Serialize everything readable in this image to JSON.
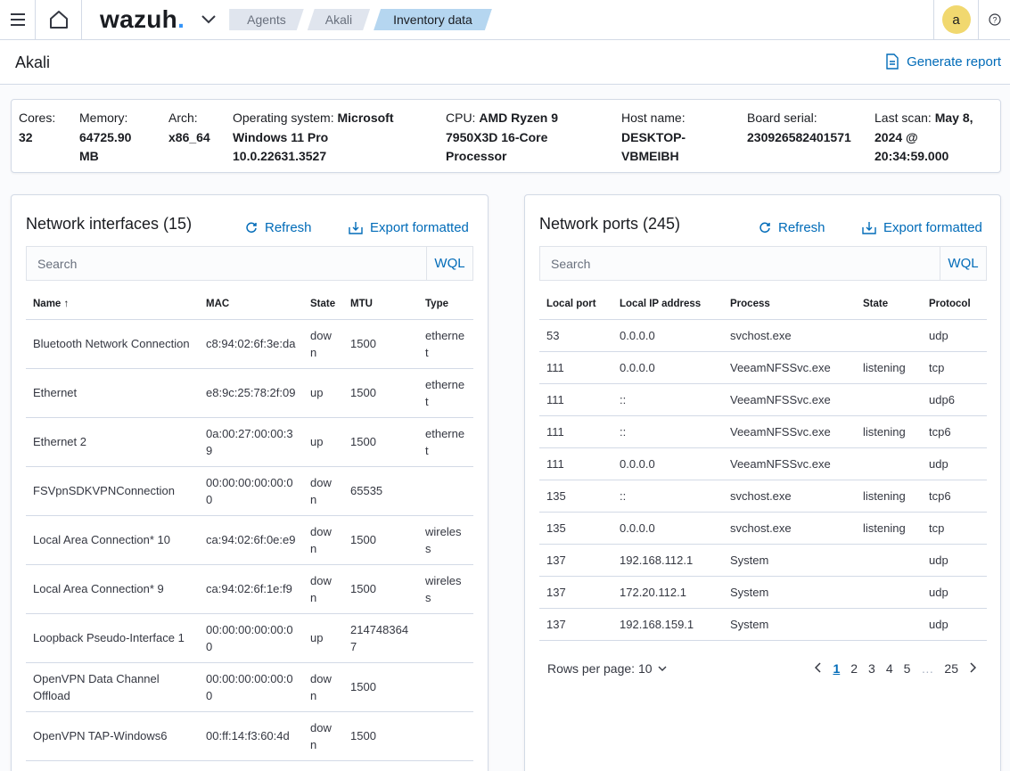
{
  "header": {
    "logo_text": "wazuh",
    "logo_dot": ".",
    "breadcrumbs": [
      "Agents",
      "Akali",
      "Inventory data"
    ],
    "avatar_letter": "a",
    "accent": "#006bb8",
    "logo_dot_color": "#3595f9"
  },
  "page": {
    "title": "Akali",
    "generate_report": "Generate report"
  },
  "info": {
    "cores_label": "Cores:",
    "cores_value": "32",
    "memory_label": "Memory:",
    "memory_value_1": "64725.90",
    "memory_value_2": "MB",
    "arch_label": "Arch:",
    "arch_value": "x86_64",
    "os_label": "Operating system:",
    "os_value_1": "Microsoft",
    "os_value_2": "Windows 11 Pro",
    "os_value_3": "10.0.22631.3527",
    "cpu_label": "CPU:",
    "cpu_value_1": "AMD Ryzen 9",
    "cpu_value_2": "7950X3D 16-Core",
    "cpu_value_3": "Processor",
    "host_label": "Host name:",
    "host_value_1": "DESKTOP-",
    "host_value_2": "VBMEIBH",
    "board_label": "Board serial:",
    "board_value": "230926582401571",
    "scan_label": "Last scan:",
    "scan_value_1": "May 8,",
    "scan_value_2": "2024 @",
    "scan_value_3": "20:34:59.000"
  },
  "interfaces": {
    "title": "Network interfaces (15)",
    "refresh": "Refresh",
    "export": "Export formatted",
    "search_placeholder": "Search",
    "wql": "WQL",
    "columns": [
      "Name",
      "MAC",
      "State",
      "MTU",
      "Type"
    ],
    "rows": [
      {
        "name": "Bluetooth Network Connection",
        "mac": "c8:94:02:6f:3e:da",
        "state": "down",
        "mtu": "1500",
        "type": "ethernet"
      },
      {
        "name": "Ethernet",
        "mac": "e8:9c:25:78:2f:09",
        "state": "up",
        "mtu": "1500",
        "type": "ethernet"
      },
      {
        "name": "Ethernet 2",
        "mac": "0a:00:27:00:00:39",
        "state": "up",
        "mtu": "1500",
        "type": "ethernet"
      },
      {
        "name": "FSVpnSDKVPNConnection",
        "mac": "00:00:00:00:00:00",
        "state": "down",
        "mtu": "65535",
        "type": ""
      },
      {
        "name": "Local Area Connection* 10",
        "mac": "ca:94:02:6f:0e:e9",
        "state": "down",
        "mtu": "1500",
        "type": "wireless"
      },
      {
        "name": "Local Area Connection* 9",
        "mac": "ca:94:02:6f:1e:f9",
        "state": "down",
        "mtu": "1500",
        "type": "wireless"
      },
      {
        "name": "Loopback Pseudo-Interface 1",
        "mac": "00:00:00:00:00:00",
        "state": "up",
        "mtu": "2147483647",
        "type": ""
      },
      {
        "name": "OpenVPN Data Channel Offload",
        "mac": "00:00:00:00:00:00",
        "state": "down",
        "mtu": "1500",
        "type": ""
      },
      {
        "name": "OpenVPN TAP-Windows6",
        "mac": "00:ff:14:f3:60:4d",
        "state": "down",
        "mtu": "1500",
        "type": ""
      }
    ]
  },
  "ports": {
    "title": "Network ports (245)",
    "refresh": "Refresh",
    "export": "Export formatted",
    "search_placeholder": "Search",
    "wql": "WQL",
    "columns": [
      "Local port",
      "Local IP address",
      "Process",
      "State",
      "Protocol"
    ],
    "rows": [
      {
        "port": "53",
        "ip": "0.0.0.0",
        "process": "svchost.exe",
        "state": "",
        "protocol": "udp"
      },
      {
        "port": "111",
        "ip": "0.0.0.0",
        "process": "VeeamNFSSvc.exe",
        "state": "listening",
        "protocol": "tcp"
      },
      {
        "port": "111",
        "ip": "::",
        "process": "VeeamNFSSvc.exe",
        "state": "",
        "protocol": "udp6"
      },
      {
        "port": "111",
        "ip": "::",
        "process": "VeeamNFSSvc.exe",
        "state": "listening",
        "protocol": "tcp6"
      },
      {
        "port": "111",
        "ip": "0.0.0.0",
        "process": "VeeamNFSSvc.exe",
        "state": "",
        "protocol": "udp"
      },
      {
        "port": "135",
        "ip": "::",
        "process": "svchost.exe",
        "state": "listening",
        "protocol": "tcp6"
      },
      {
        "port": "135",
        "ip": "0.0.0.0",
        "process": "svchost.exe",
        "state": "listening",
        "protocol": "tcp"
      },
      {
        "port": "137",
        "ip": "192.168.112.1",
        "process": "System",
        "state": "",
        "protocol": "udp"
      },
      {
        "port": "137",
        "ip": "172.20.112.1",
        "process": "System",
        "state": "",
        "protocol": "udp"
      },
      {
        "port": "137",
        "ip": "192.168.159.1",
        "process": "System",
        "state": "",
        "protocol": "udp"
      }
    ],
    "rows_per_page_label": "Rows per page: 10",
    "pages": [
      "1",
      "2",
      "3",
      "4",
      "5",
      "…",
      "25"
    ],
    "current_page": "1"
  }
}
